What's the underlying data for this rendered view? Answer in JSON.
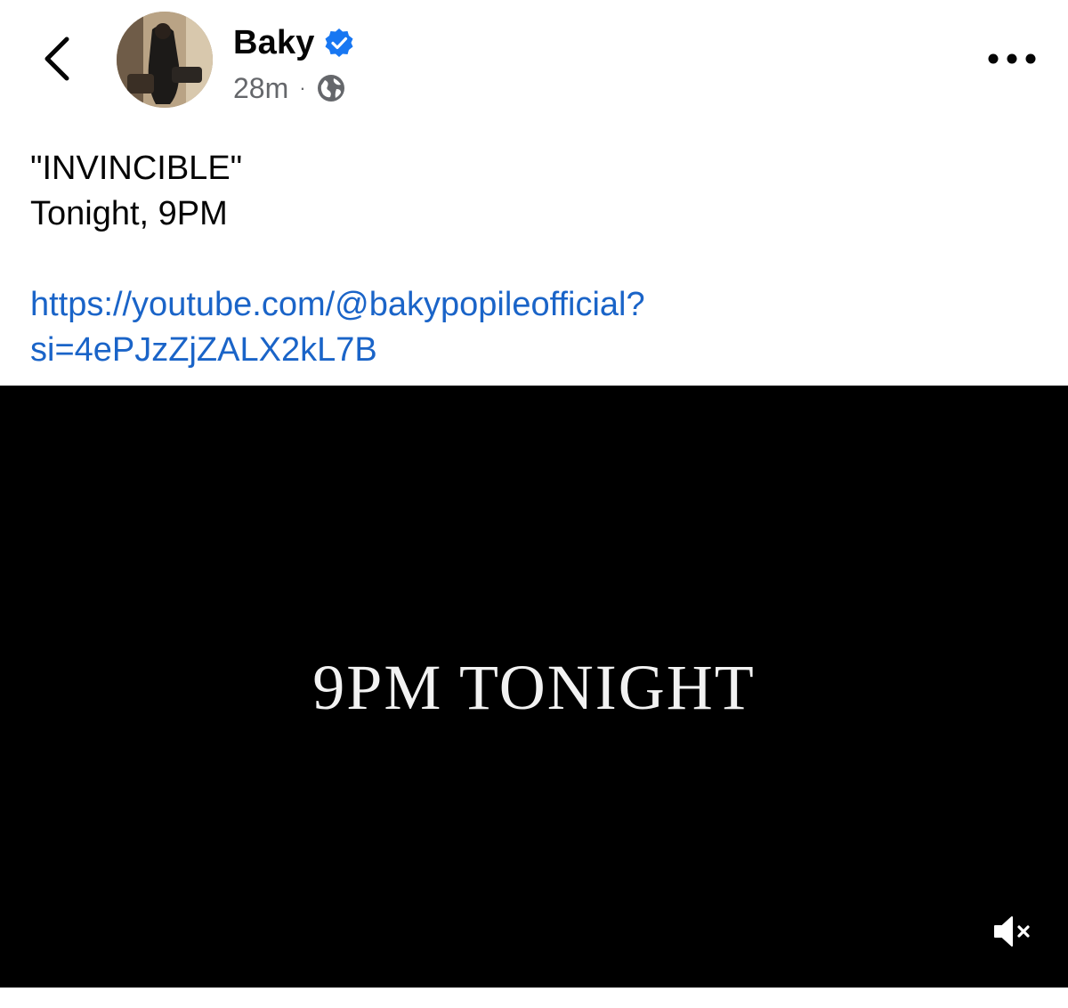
{
  "header": {
    "author_name": "Baky",
    "timestamp": "28m",
    "separator": "·",
    "privacy_icon": "globe-icon",
    "back_icon": "chevron-left-icon",
    "more_icon": "more-horizontal-icon",
    "verified_icon": "verified-badge-icon",
    "accent_color": "#1877f2"
  },
  "post": {
    "title_line": "\"INVINCIBLE\"",
    "time_line": "Tonight, 9PM",
    "link_line_1": "https://youtube.com/@bakypopileofficial?",
    "link_line_2": "si=4ePJzZjZALX2kL7B",
    "link_color": "#1a64c8"
  },
  "video": {
    "overlay_text": "9PM TONIGHT",
    "mute_icon": "speaker-muted-icon"
  }
}
